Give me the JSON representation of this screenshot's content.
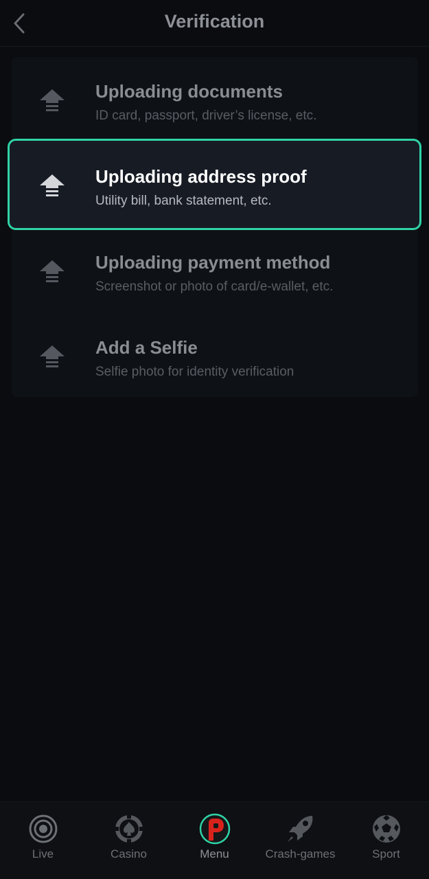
{
  "header": {
    "title": "Verification"
  },
  "verification_items": [
    {
      "title": "Uploading documents",
      "subtitle": "ID card, passport, driver’s license, etc."
    },
    {
      "title": "Uploading address proof",
      "subtitle": "Utility bill, bank statement, etc."
    },
    {
      "title": "Uploading payment method",
      "subtitle": "Screenshot or photo of card/e-wallet, etc."
    },
    {
      "title": "Add a Selfie",
      "subtitle": "Selfie photo for identity verification"
    }
  ],
  "bottom_nav": {
    "items": [
      {
        "label": "Live",
        "icon": "live-icon"
      },
      {
        "label": "Casino",
        "icon": "casino-chip-icon"
      },
      {
        "label": "Menu",
        "icon": "menu-logo-icon"
      },
      {
        "label": "Crash-games",
        "icon": "rocket-icon"
      },
      {
        "label": "Sport",
        "icon": "soccer-ball-icon"
      }
    ]
  },
  "colors": {
    "background": "#0a0c10",
    "accent": "#2fd3a6",
    "menu_logo_red": "#d8231c"
  }
}
